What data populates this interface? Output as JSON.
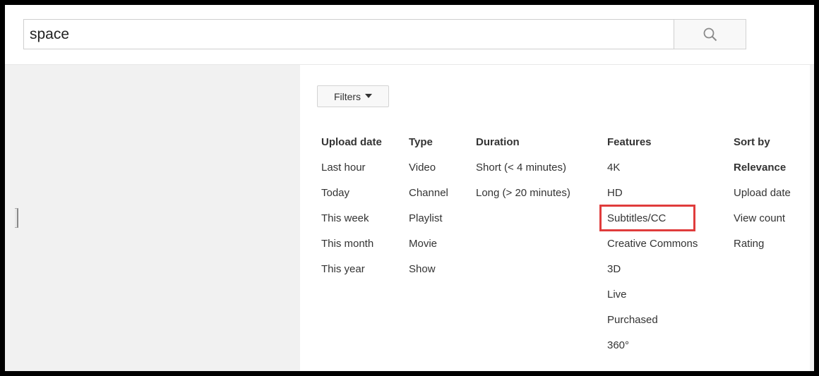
{
  "search": {
    "query": "space",
    "icon": "search-icon"
  },
  "filters": {
    "button_label": "Filters",
    "icon": "caret-down-icon"
  },
  "columns": [
    {
      "header": "Upload date",
      "options": [
        "Last hour",
        "Today",
        "This week",
        "This month",
        "This year"
      ]
    },
    {
      "header": "Type",
      "options": [
        "Video",
        "Channel",
        "Playlist",
        "Movie",
        "Show"
      ]
    },
    {
      "header": "Duration",
      "options": [
        "Short (< 4 minutes)",
        "Long (> 20 minutes)"
      ]
    },
    {
      "header": "Features",
      "options": [
        "4K",
        "HD",
        "Subtitles/CC",
        "Creative Commons",
        "3D",
        "Live",
        "Purchased",
        "360°"
      ]
    },
    {
      "header": "Sort by",
      "options": [
        "Relevance",
        "Upload date",
        "View count",
        "Rating"
      ]
    }
  ],
  "selected_sort": "Relevance",
  "highlighted_option": "Subtitles/CC",
  "colors": {
    "highlight_box": "#e03c3c",
    "gutter": "#f1f1f1",
    "frame": "#000000"
  }
}
